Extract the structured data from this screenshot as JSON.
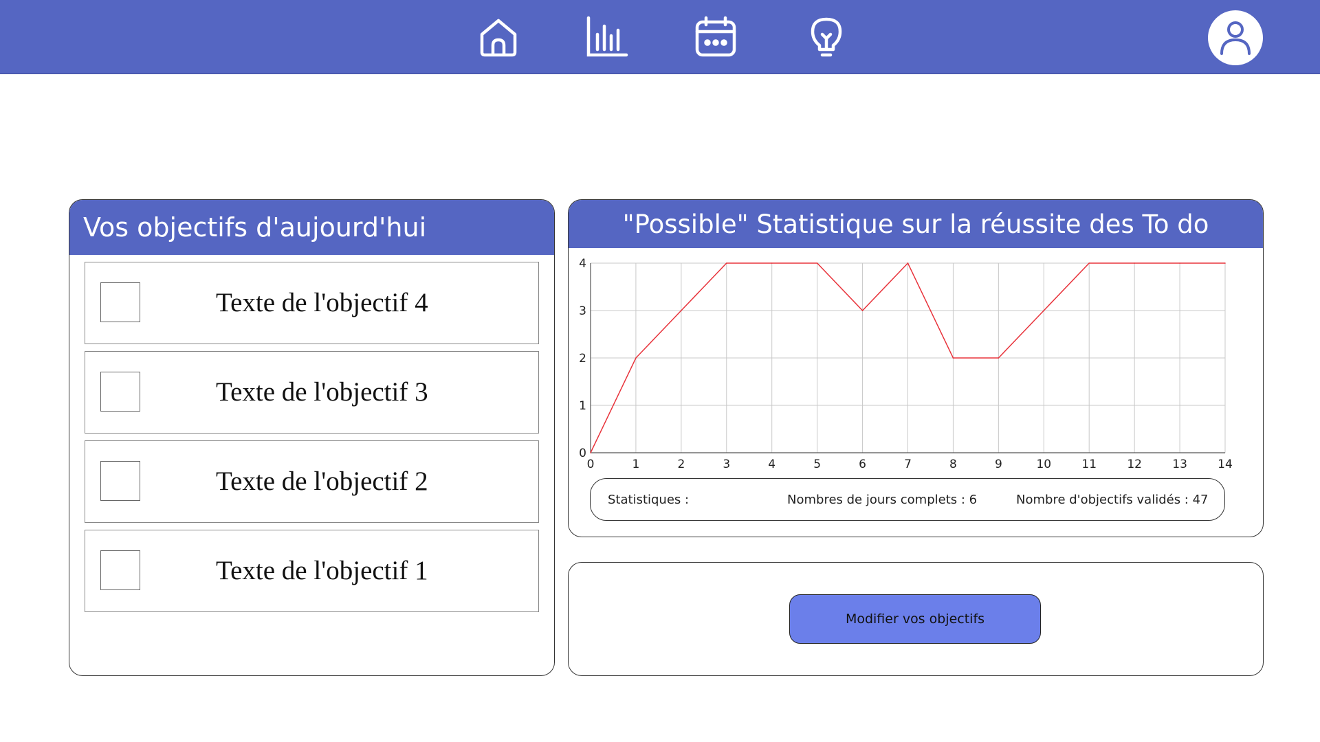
{
  "nav": {
    "items": [
      {
        "icon": "home-icon"
      },
      {
        "icon": "bar-chart-icon"
      },
      {
        "icon": "calendar-icon"
      },
      {
        "icon": "lightbulb-icon"
      }
    ],
    "profile_icon": "user-icon"
  },
  "objectives": {
    "title": "Vos objectifs d'aujourd'hui",
    "items": [
      {
        "text": "Texte de l'objectif 4",
        "checked": false
      },
      {
        "text": "Texte de l'objectif 3",
        "checked": false
      },
      {
        "text": "Texte de l'objectif 2",
        "checked": false
      },
      {
        "text": "Texte de l'objectif 1",
        "checked": false
      }
    ]
  },
  "stats": {
    "title": "\"Possible\" Statistique sur la réussite des To do",
    "summary": {
      "label": "Statistiques :",
      "complete_days": "Nombres de jours complets : 6",
      "validated_objectives": "Nombre d'objectifs validés : 47"
    }
  },
  "chart_data": {
    "type": "line",
    "x": [
      0,
      1,
      2,
      3,
      4,
      5,
      6,
      7,
      8,
      9,
      10,
      11,
      12,
      13,
      14
    ],
    "series": [
      {
        "values": [
          0,
          2,
          3,
          4,
          4,
          4,
          3,
          4,
          2,
          2,
          3,
          4,
          4,
          4,
          4
        ]
      }
    ],
    "xlim": [
      0,
      14
    ],
    "ylim": [
      0,
      4
    ],
    "xticks": [
      0,
      1,
      2,
      3,
      4,
      5,
      6,
      7,
      8,
      9,
      10,
      11,
      12,
      13,
      14
    ],
    "yticks": [
      0,
      1,
      2,
      3,
      4
    ],
    "grid": true,
    "line_color": "#e8333b"
  },
  "actions": {
    "modify_label": "Modifier vos objectifs"
  },
  "colors": {
    "brand": "#5566c2",
    "button": "#6b7fea"
  }
}
